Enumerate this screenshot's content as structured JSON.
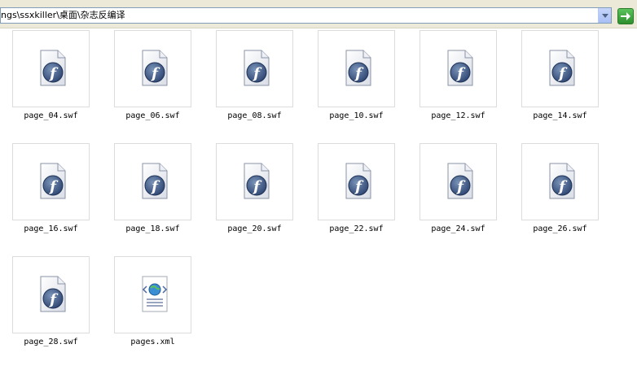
{
  "address": {
    "path": "ngs\\ssxkiller\\桌面\\杂志反编译"
  },
  "files": [
    {
      "name": "page_04.swf",
      "icon": "flash-file-icon"
    },
    {
      "name": "page_06.swf",
      "icon": "flash-file-icon"
    },
    {
      "name": "page_08.swf",
      "icon": "flash-file-icon"
    },
    {
      "name": "page_10.swf",
      "icon": "flash-file-icon"
    },
    {
      "name": "page_12.swf",
      "icon": "flash-file-icon"
    },
    {
      "name": "page_14.swf",
      "icon": "flash-file-icon"
    },
    {
      "name": "page_16.swf",
      "icon": "flash-file-icon"
    },
    {
      "name": "page_18.swf",
      "icon": "flash-file-icon"
    },
    {
      "name": "page_20.swf",
      "icon": "flash-file-icon"
    },
    {
      "name": "page_22.swf",
      "icon": "flash-file-icon"
    },
    {
      "name": "page_24.swf",
      "icon": "flash-file-icon"
    },
    {
      "name": "page_26.swf",
      "icon": "flash-file-icon"
    },
    {
      "name": "page_28.swf",
      "icon": "flash-file-icon"
    },
    {
      "name": "pages.xml",
      "icon": "xml-file-icon"
    }
  ]
}
